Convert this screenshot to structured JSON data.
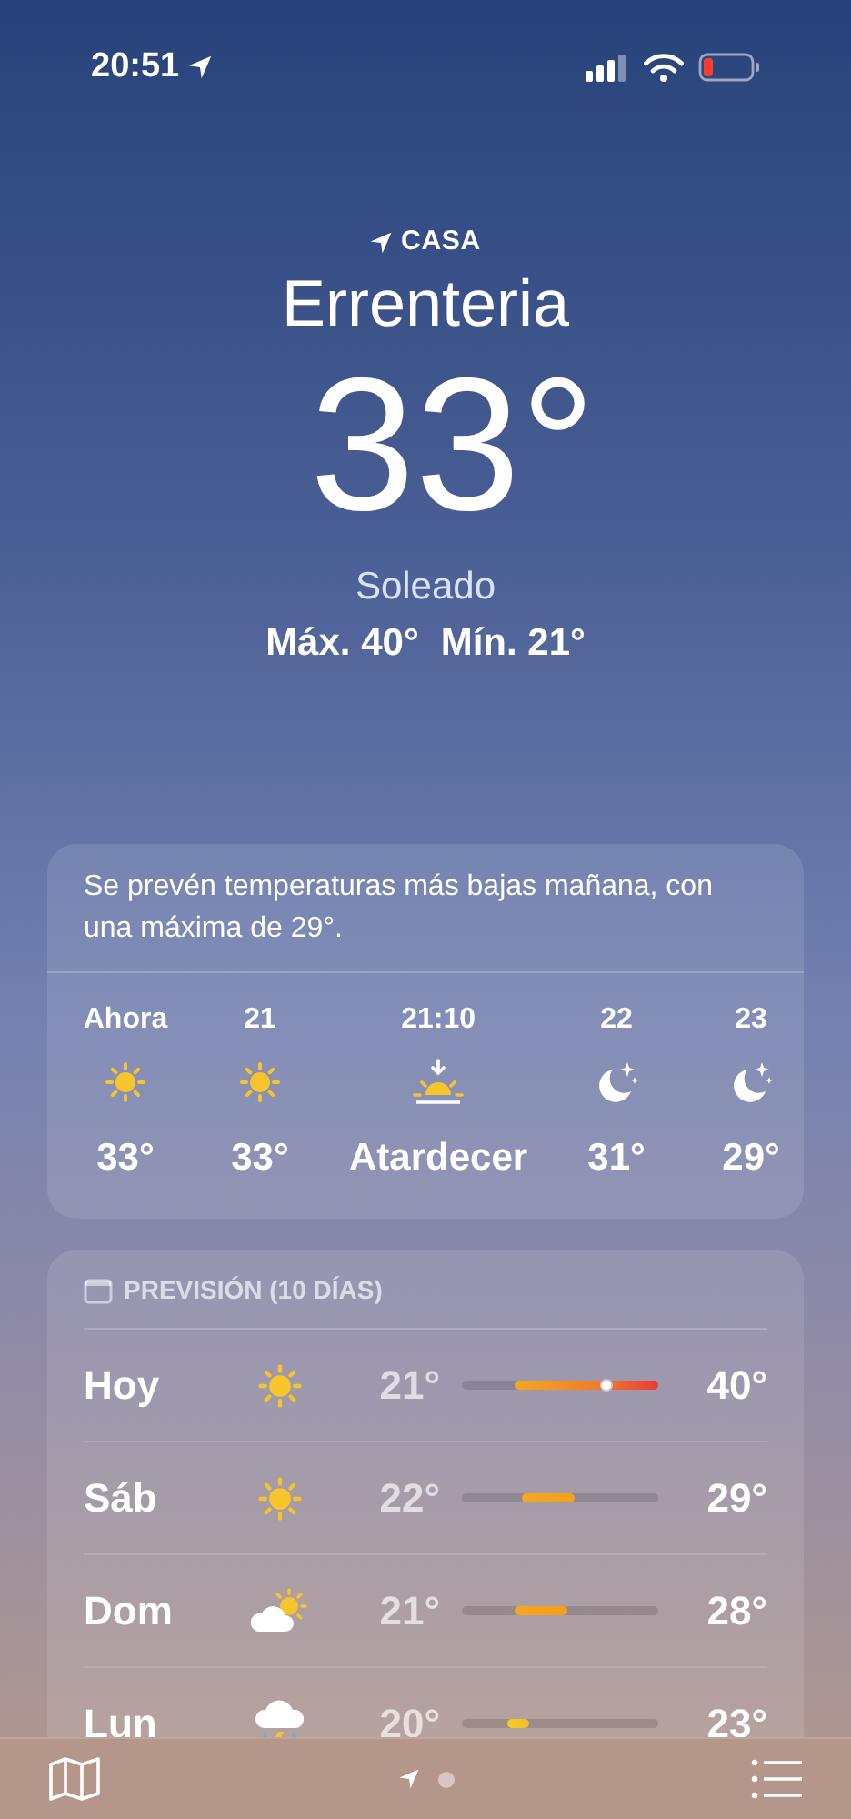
{
  "status_bar": {
    "time": "20:51"
  },
  "location": {
    "label": "CASA",
    "city": "Errenteria",
    "temperature": "33°",
    "condition": "Soleado",
    "high": "Máx. 40°",
    "low": "Mín. 21°"
  },
  "hourly": {
    "summary": "Se prevén temperaturas más bajas mañana, con una máxima de 29°.",
    "items": [
      {
        "time": "Ahora",
        "kind": "sun",
        "value": "33°"
      },
      {
        "time": "21",
        "kind": "sun",
        "value": "33°"
      },
      {
        "time": "21:10",
        "kind": "sunset",
        "value": "Atardecer"
      },
      {
        "time": "22",
        "kind": "moon",
        "value": "31°"
      },
      {
        "time": "23",
        "kind": "moon",
        "value": "29°"
      }
    ]
  },
  "daily": {
    "title": "PREVISIÓN (10 DÍAS)",
    "days": [
      {
        "day": "Hoy",
        "kind": "sun",
        "low": "21°",
        "high": "40°",
        "now_dot": true
      },
      {
        "day": "Sáb",
        "kind": "sun",
        "low": "22°",
        "high": "29°",
        "now_dot": false
      },
      {
        "day": "Dom",
        "kind": "partly_cloudy",
        "low": "21°",
        "high": "28°",
        "now_dot": false
      },
      {
        "day": "Lun",
        "kind": "storm",
        "low": "20°",
        "high": "23°",
        "now_dot": false
      }
    ]
  },
  "pages": [
    {
      "kind": "location",
      "selected": true
    },
    {
      "kind": "dot",
      "selected": false
    }
  ]
}
